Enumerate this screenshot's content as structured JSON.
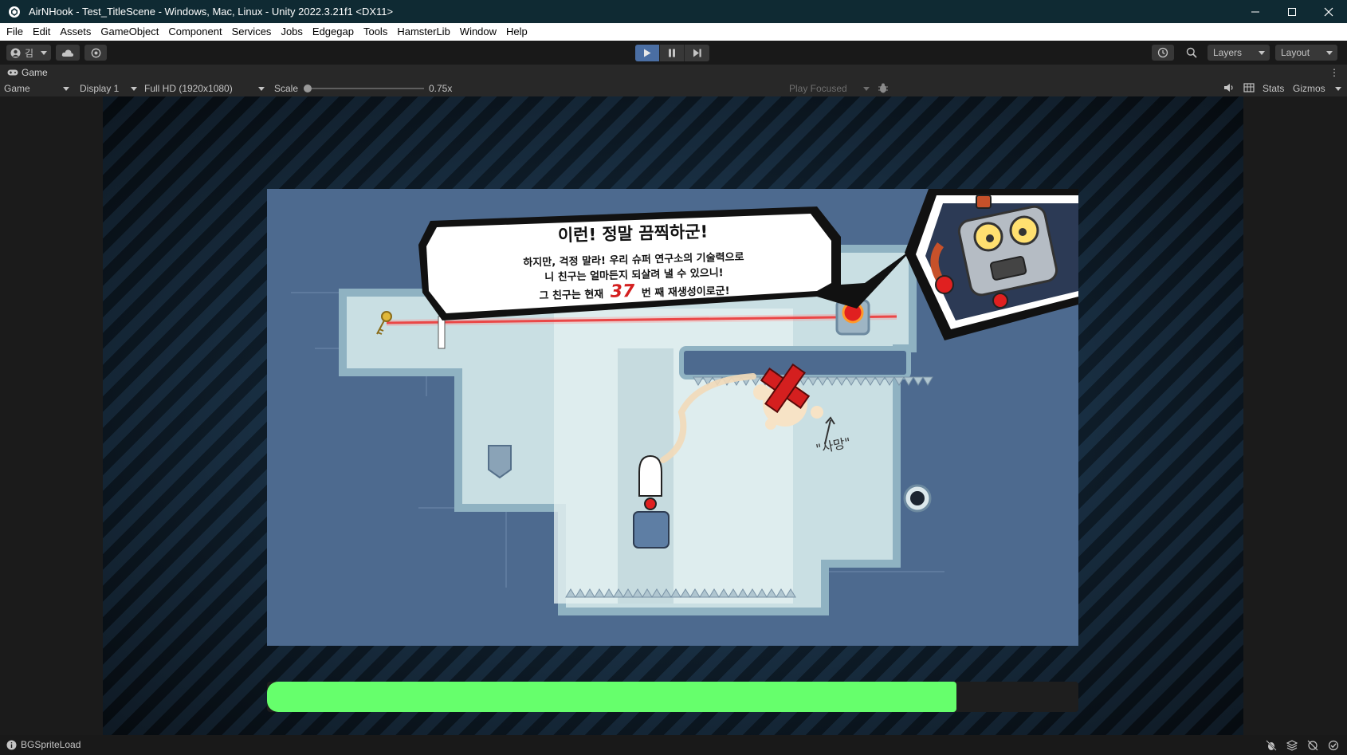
{
  "window": {
    "title": "AirNHook - Test_TitleScene - Windows, Mac, Linux - Unity 2022.3.21f1 <DX11>"
  },
  "menu": [
    "File",
    "Edit",
    "Assets",
    "GameObject",
    "Component",
    "Services",
    "Jobs",
    "Edgegap",
    "Tools",
    "HamsterLib",
    "Window",
    "Help"
  ],
  "toolbar": {
    "account_label": "김",
    "layers_label": "Layers",
    "layout_label": "Layout"
  },
  "tab": {
    "label": "Game"
  },
  "gamebar": {
    "view_mode": "Game",
    "display": "Display 1",
    "resolution": "Full HD (1920x1080)",
    "scale_label": "Scale",
    "scale_value": "0.75x",
    "play_mode": "Play Focused",
    "stats": "Stats",
    "gizmos": "Gizmos"
  },
  "dialog": {
    "headline": "이런! 정말 끔찍하군!",
    "line1": "하지만, 걱정 말라! 우리 슈퍼 연구소의 기술력으로",
    "line2": "니 친구는 얼마든지 되살려 낼 수 있으니!",
    "line3_prefix": "그 친구는 현재",
    "count": "37",
    "line3_suffix": "번 째 재생성이로군!"
  },
  "scene": {
    "death_label": "\"사망\""
  },
  "progress": {
    "fraction": 0.85
  },
  "statusbar": {
    "message": "BGSpriteLoad"
  },
  "colors": {
    "title_bar": "#0f2a33",
    "play_active": "#4a6ea3",
    "progress_fill": "#66ff6c",
    "scene_bg": "#4d6a8f",
    "red_accent": "#e02020"
  }
}
